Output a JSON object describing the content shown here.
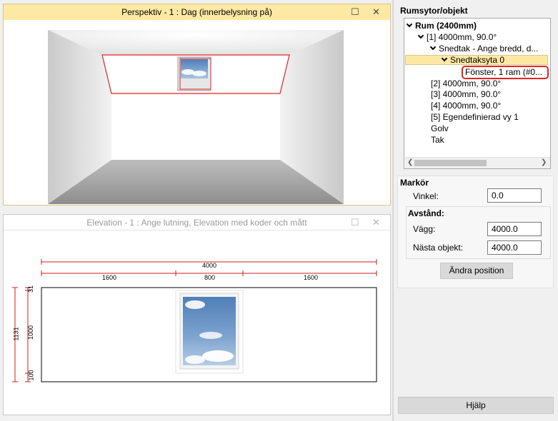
{
  "perspective": {
    "title": "Perspektiv - 1 : Dag (innerbelysning på)",
    "maximize_glyph": "☐",
    "close_glyph": "✕"
  },
  "elevation": {
    "title": "Elevation - 1 : Ange lutning, Elevation med koder och mått",
    "maximize_glyph": "☐",
    "close_glyph": "✕",
    "dims": {
      "total_width": "4000",
      "seg_left": "1600",
      "seg_mid": "800",
      "seg_right": "1600",
      "height_total": "1131",
      "height_top": "31",
      "height_mid": "1000",
      "height_bottom": "100"
    }
  },
  "rumsytor": {
    "title": "Rumsytor/objekt",
    "tree": [
      {
        "label": "Rum (2400mm)",
        "bold": true
      },
      {
        "label": "[1]  4000mm, 90.0°"
      },
      {
        "label": "Snedtak - Ange bredd, d..."
      },
      {
        "label": "Snedtaksyta 0"
      },
      {
        "label": "Fönster, 1 ram (#0..."
      },
      {
        "label": "[2]  4000mm, 90.0°"
      },
      {
        "label": "[3]  4000mm, 90.0°"
      },
      {
        "label": "[4]  4000mm, 90.0°"
      },
      {
        "label": "[5] Egendefinierad vy 1"
      },
      {
        "label": "Golv"
      },
      {
        "label": "Tak"
      }
    ]
  },
  "markor": {
    "title": "Markör",
    "vinkel_label": "Vinkel:",
    "vinkel_value": "0.0",
    "avstand_title": "Avstånd:",
    "vagg_label": "Vägg:",
    "vagg_value": "4000.0",
    "nasta_label": "Nästa objekt:",
    "nasta_value": "4000.0",
    "andra_button": "Ändra position"
  },
  "help_button": "Hjälp",
  "colors": {
    "accent_selection": "#fde9a3",
    "focus_red": "#e02424",
    "dimension_red": "#cc1f1f"
  }
}
